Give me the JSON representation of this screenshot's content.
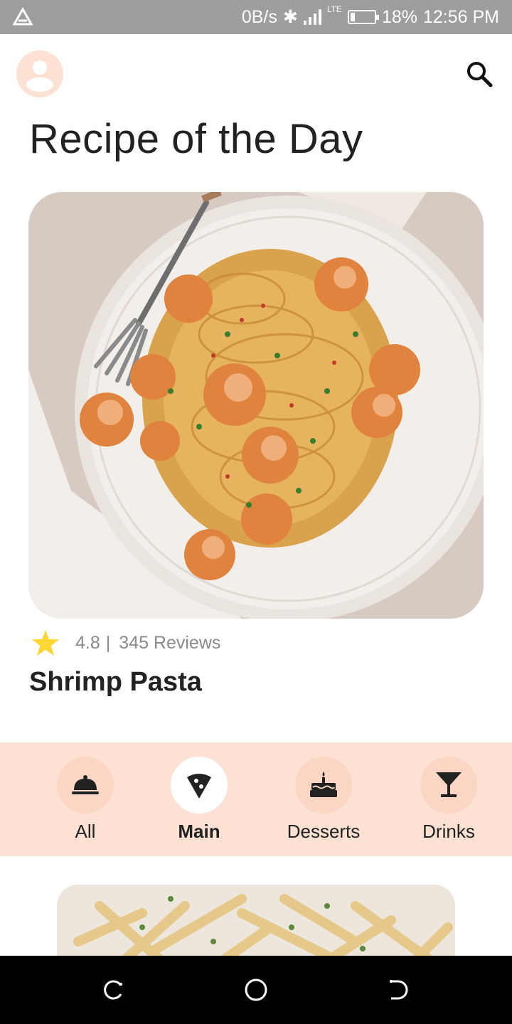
{
  "status_bar": {
    "speed": "0B/s",
    "network_type": "LTE",
    "battery": "18%",
    "time": "12:56 PM",
    "battery_level": 0.18
  },
  "header": {
    "title": "Recipe of the Day",
    "avatar_icon": "user-icon",
    "search_icon": "search-icon"
  },
  "featured": {
    "rating": "4.8",
    "separator": "|",
    "reviews": "345 Reviews",
    "name": "Shrimp Pasta",
    "star_color": "#fdd835"
  },
  "categories": [
    {
      "label": "All",
      "icon": "cloche-icon",
      "active": false
    },
    {
      "label": "Main",
      "icon": "pizza-slice-icon",
      "active": true
    },
    {
      "label": "Desserts",
      "icon": "cake-icon",
      "active": false
    },
    {
      "label": "Drinks",
      "icon": "cocktail-icon",
      "active": false
    }
  ],
  "colors": {
    "accent_bg": "#fde2d3",
    "icon_circle": "#fbd6c4",
    "text": "#222222"
  }
}
